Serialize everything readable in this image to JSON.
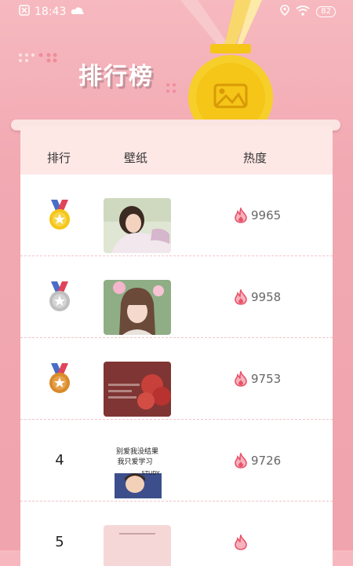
{
  "status": {
    "time": "18:43",
    "battery": "82"
  },
  "header": {
    "title": "排行榜"
  },
  "table": {
    "col_rank": "排行",
    "col_wallpaper": "壁纸",
    "col_heat": "热度"
  },
  "rows": [
    {
      "rank": "",
      "medal": "gold",
      "thumb": "girl-pink-background",
      "heat": "9965"
    },
    {
      "rank": "",
      "medal": "silver",
      "thumb": "girl-bob-hair-flowers",
      "heat": "9958"
    },
    {
      "rank": "",
      "medal": "bronze",
      "thumb": "strawberries-dark-red",
      "heat": "9753"
    },
    {
      "rank": "4",
      "medal": "",
      "thumb": "handwritten-text-cartoon",
      "thumb_text_1": "别爱我没结果",
      "thumb_text_2": "我只爱学习",
      "thumb_text_3": "STUDY",
      "heat": "9726"
    },
    {
      "rank": "5",
      "medal": "",
      "thumb": "pink-text-card",
      "heat": ""
    }
  ],
  "colors": {
    "accent": "#f0a4ad",
    "flame": "#e8536a",
    "gold": "#f5c518",
    "silver": "#c8c8c8",
    "bronze": "#d98a2b"
  }
}
